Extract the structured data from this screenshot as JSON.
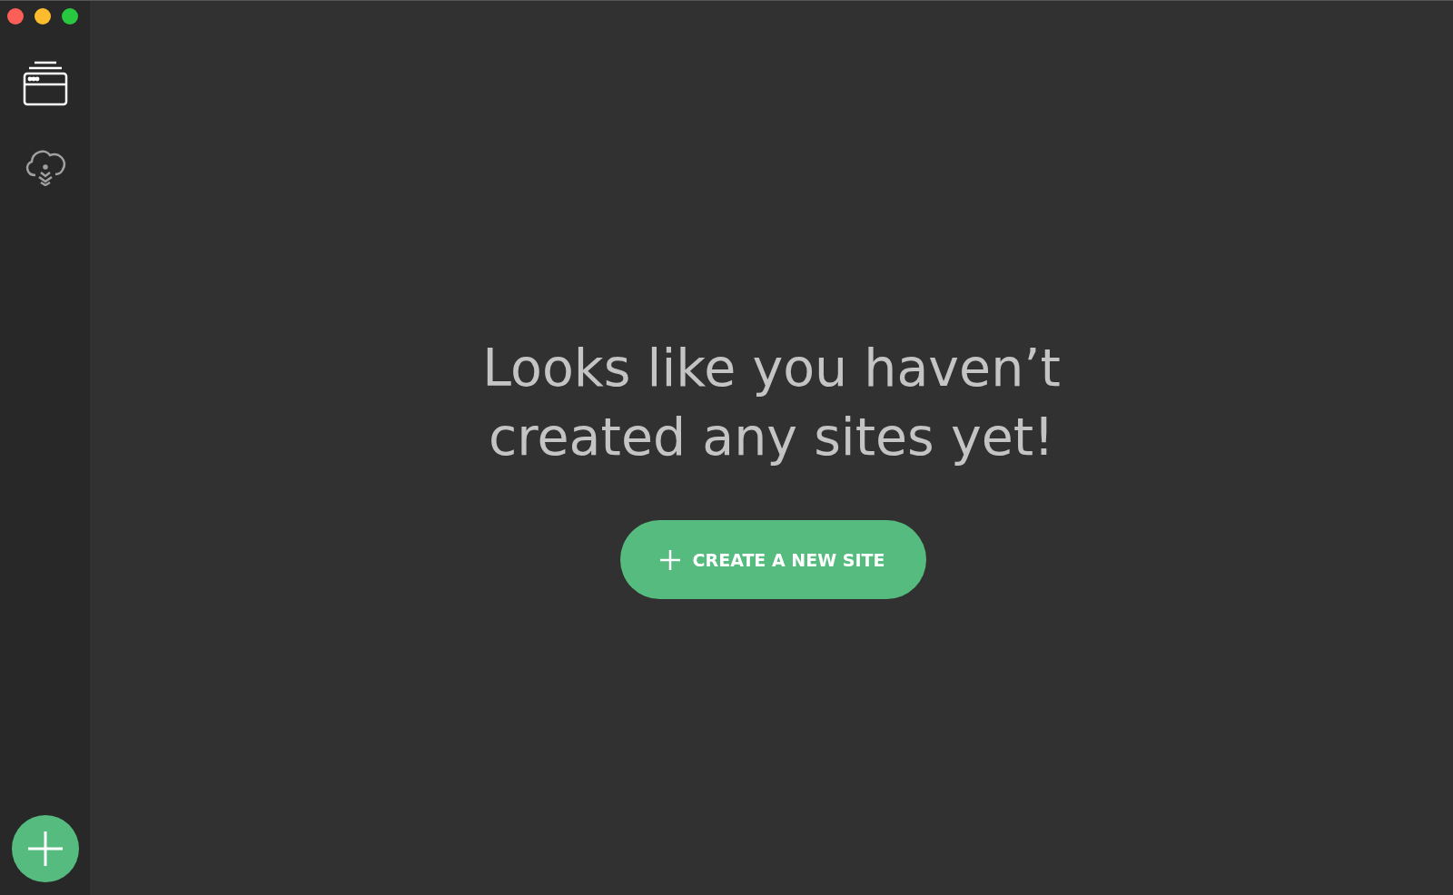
{
  "sidebar": {
    "items": [
      {
        "kind": "sites",
        "selected": true
      },
      {
        "kind": "connect",
        "selected": false
      }
    ]
  },
  "empty_state": {
    "message": "Looks like you haven’t created any sites yet!",
    "button": "CREATE A NEW SITE"
  }
}
